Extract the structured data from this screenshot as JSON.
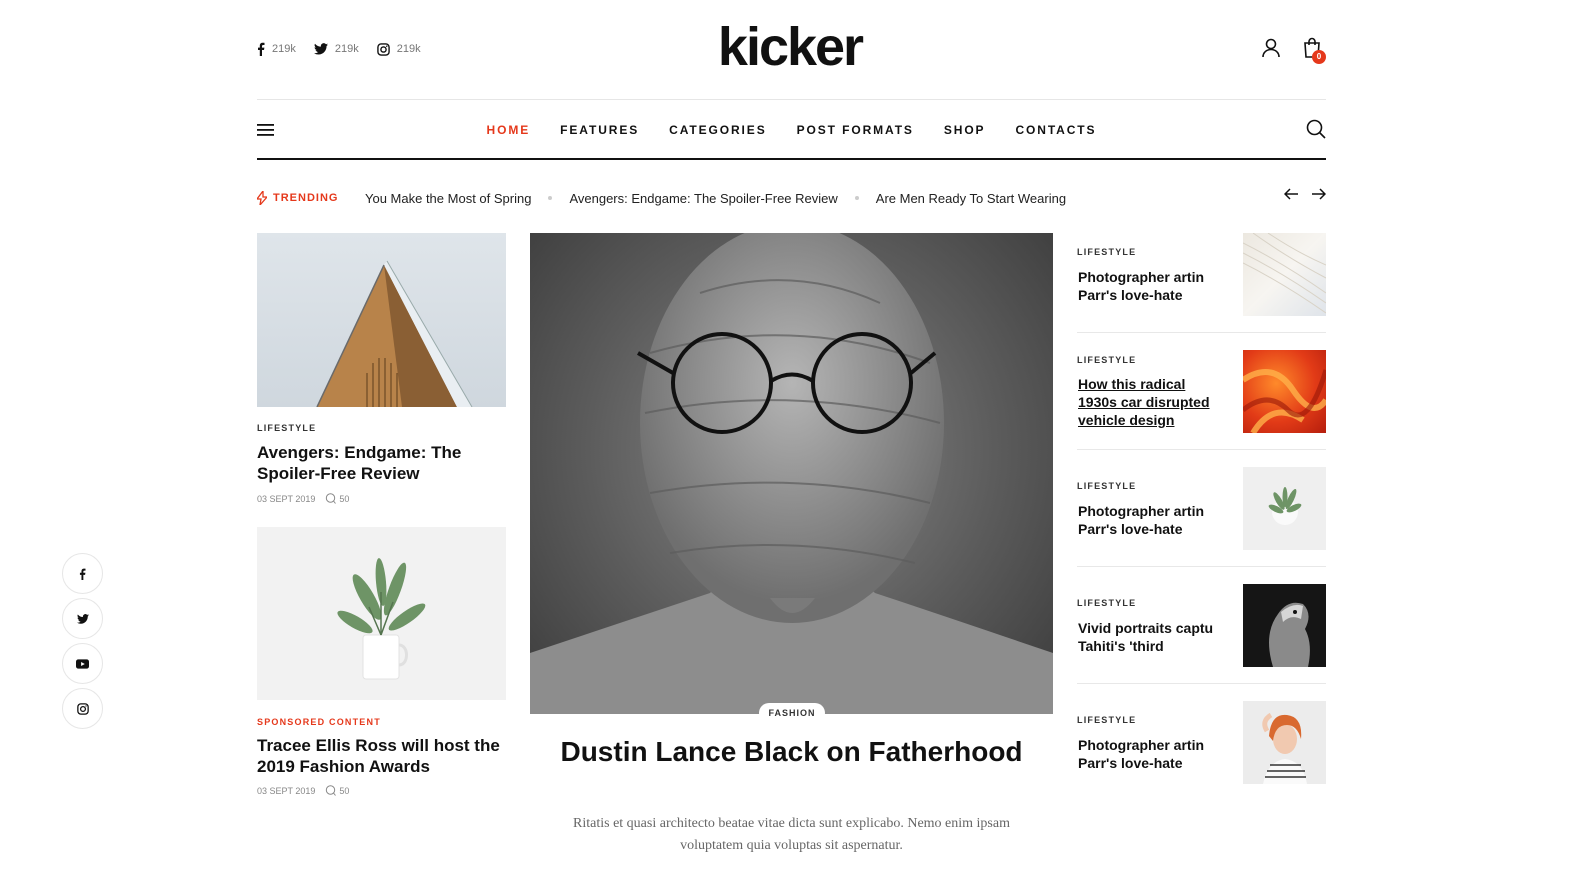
{
  "header": {
    "logo": "kicker",
    "social": [
      {
        "icon": "facebook-icon",
        "count": "219k"
      },
      {
        "icon": "twitter-icon",
        "count": "219k"
      },
      {
        "icon": "instagram-icon",
        "count": "219k"
      }
    ],
    "cart_count": "0"
  },
  "nav": {
    "items": [
      "HOME",
      "FEATURES",
      "CATEGORIES",
      "POST FORMATS",
      "SHOP",
      "CONTACTS"
    ],
    "active": "HOME"
  },
  "trending": {
    "label": "TRENDING",
    "items": [
      "You Make the Most of Spring",
      "Avengers: Endgame: The Spoiler-Free Review",
      "Are Men Ready To Start Wearing"
    ]
  },
  "left_posts": [
    {
      "category": "LIFESTYLE",
      "title": "Avengers: Endgame: The Spoiler-Free Review",
      "date": "03 SEPT 2019",
      "comments": "50"
    },
    {
      "category": "SPONSORED CONTENT",
      "title": "Tracee Ellis Ross will host the 2019 Fashion Awards",
      "date": "03 SEPT 2019",
      "comments": "50"
    }
  ],
  "hero": {
    "category": "FASHION",
    "title": "Dustin Lance Black on Fatherhood",
    "excerpt": "Ritatis et quasi architecto beatae vitae dicta sunt explicabo. Nemo enim ipsam voluptatem quia voluptas sit aspernatur."
  },
  "side_posts": [
    {
      "category": "LIFESTYLE",
      "title": "Photographer artin Parr's love-hate",
      "thumb": "white-fabric"
    },
    {
      "category": "LIFESTYLE",
      "title": "How this radical 1930s car disrupted vehicle design",
      "thumb": "red-orange-abstract"
    },
    {
      "category": "LIFESTYLE",
      "title": "Photographer artin Parr's love-hate",
      "thumb": "small-plant"
    },
    {
      "category": "LIFESTYLE",
      "title": "Vivid portraits captu Tahiti's 'third",
      "thumb": "bw-dog"
    },
    {
      "category": "LIFESTYLE",
      "title": "Photographer artin Parr's love-hate",
      "thumb": "red-hair-woman"
    }
  ],
  "floating_social": [
    "facebook-icon",
    "twitter-icon",
    "youtube-icon",
    "instagram-icon"
  ],
  "colors": {
    "accent": "#e5381b",
    "text": "#111111",
    "muted": "#888888"
  }
}
